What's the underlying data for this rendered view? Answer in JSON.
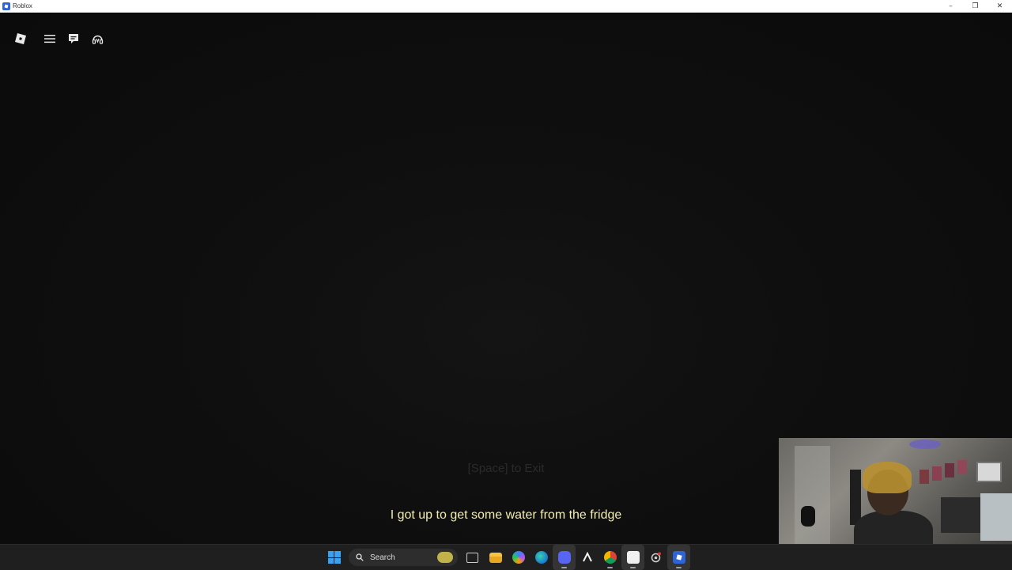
{
  "window": {
    "title": "Roblox"
  },
  "game": {
    "hint_text": "[Space] to Exit",
    "subtitle": "I got up to get some water from the fridge"
  },
  "taskbar": {
    "search_label": "Search"
  },
  "colors": {
    "background": "#0d0d0d",
    "subtitle": "#f2edb0",
    "taskbar": "#1f1f1f",
    "roblox_blue": "#2f63d8"
  },
  "icons": {
    "topbar": [
      "roblox-logo-icon",
      "menu-icon",
      "chat-icon",
      "headset-icon"
    ],
    "taskbar": [
      "windows-start-icon",
      "search-icon",
      "task-view-icon",
      "file-explorer-icon",
      "copilot-icon",
      "edge-icon",
      "discord-icon",
      "capcut-icon",
      "chrome-icon",
      "app-icon",
      "settings-icon",
      "roblox-icon"
    ]
  }
}
